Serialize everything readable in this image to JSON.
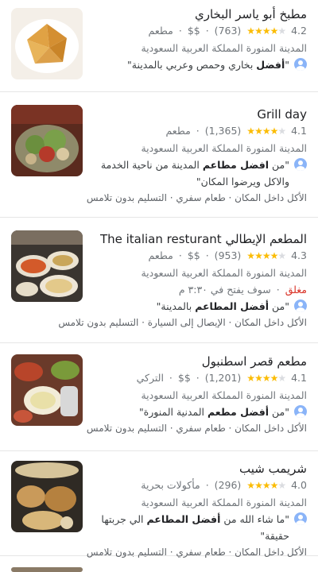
{
  "results": [
    {
      "name": "مطبخ أبو ياسر البخاري",
      "rating": "4.2",
      "stars": 4,
      "reviews": "(763)",
      "price": "$$",
      "category": "مطعم",
      "address": "المدينة المنورة المملكة العربية السعودية",
      "quote_pre": "\"",
      "quote_bold": "أفضل",
      "quote_post": " بخاري وحمص وعربي بالمدينة\"",
      "services": ""
    },
    {
      "name": "Grill day",
      "rating": "4.1",
      "stars": 4,
      "reviews": "(1,365)",
      "price": "",
      "category": "مطعم",
      "address": "المدينة المنورة المملكة العربية السعودية",
      "quote_pre": "\"من ",
      "quote_bold": "افضل مطاعم",
      "quote_post": " المدينة من ناحية الخدمة والاكل ويرضوا المكان\"",
      "services": "الأكل داخل المكان · طعام سفري · التسليم بدون تلامس"
    },
    {
      "name": "المطعم الإيطالي The italian resturant",
      "rating": "4.3",
      "stars": 4,
      "reviews": "(953)",
      "price": "$$",
      "category": "مطعم",
      "address": "المدينة المنورة المملكة العربية السعودية",
      "status_closed": "مغلق",
      "status_opens": "سوف يفتح في ٣:٣٠ م",
      "quote_pre": "\"من ",
      "quote_bold": "أفضل المطاعم",
      "quote_post": " بالمدينة\"",
      "services": "الأكل داخل المكان · الإيصال إلى السيارة · التسليم بدون تلامس"
    },
    {
      "name": "مطعم قصر اسطنبول",
      "rating": "4.1",
      "stars": 4,
      "reviews": "(1,201)",
      "price": "$$",
      "category": "التركي",
      "address": "المدينة المنورة المملكة العربية السعودية",
      "quote_pre": "\"من ",
      "quote_bold": "أفضل مطعم",
      "quote_post": " المدنية المنورة\"",
      "services": "الأكل داخل المكان · طعام سفري · التسليم بدون تلامس"
    },
    {
      "name": "شريمب شيب",
      "rating": "4.0",
      "stars": 4,
      "reviews": "(296)",
      "price": "",
      "category": "مأكولات بحرية",
      "address": "المدينة المنورة المملكة العربية السعودية",
      "quote_pre": "\"ما شاء الله من ",
      "quote_bold": "أفضل المطاعم",
      "quote_post": " الي جربتها حقيقة\"",
      "services": "الأكل داخل المكان · طعام سفري · التسليم بدون تلامس"
    }
  ],
  "colors": {
    "star": "#fbbc04",
    "closed": "#d93025",
    "avatar": "#8ab4f8"
  }
}
